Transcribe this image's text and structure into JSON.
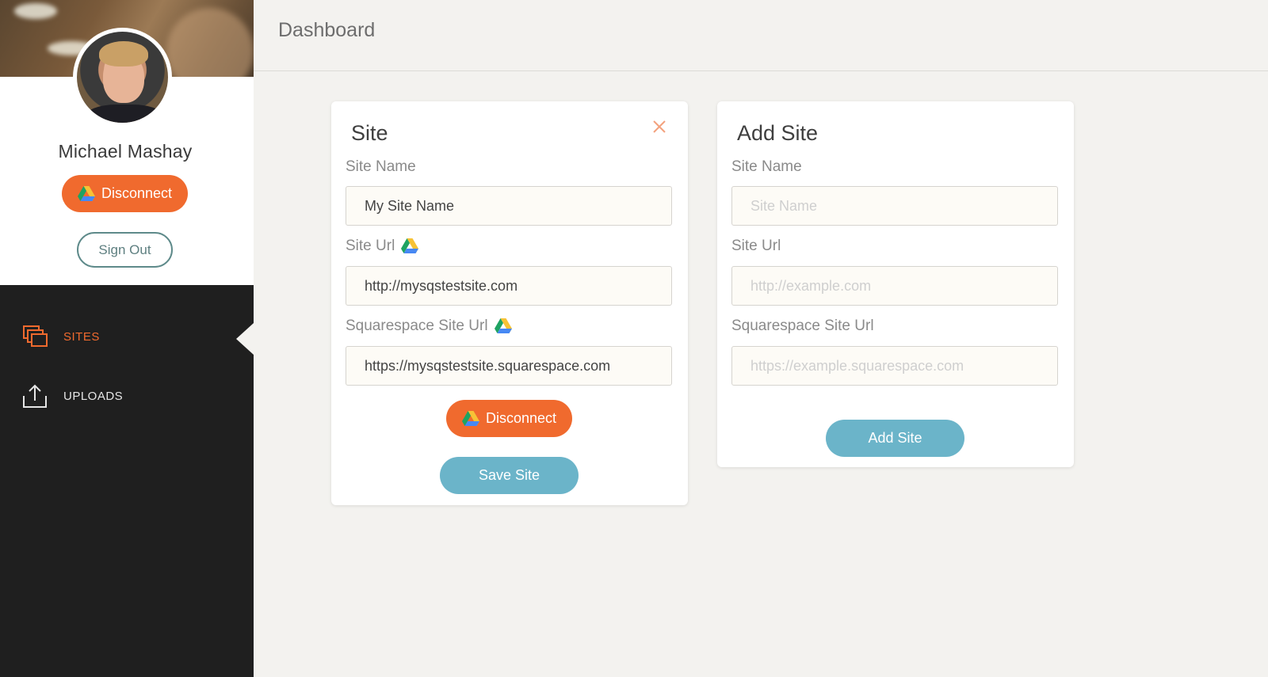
{
  "user": {
    "name": "Michael Mashay",
    "disconnect_label": "Disconnect",
    "signout_label": "Sign Out"
  },
  "nav": {
    "items": [
      {
        "label": "SITES",
        "icon": "sites-icon",
        "active": true
      },
      {
        "label": "UPLOADS",
        "icon": "upload-icon",
        "active": false
      }
    ]
  },
  "header": {
    "title": "Dashboard"
  },
  "site_card": {
    "title": "Site",
    "fields": [
      {
        "label": "Site Name",
        "value": "My Site Name"
      },
      {
        "label": "Site Url",
        "value": "http://mysqstestsite.com"
      },
      {
        "label": "Squarespace Site Url",
        "value": "https://mysqstestsite.squarespace.com"
      }
    ],
    "disconnect_label": "Disconnect",
    "save_label": "Save Site"
  },
  "add_card": {
    "title": "Add Site",
    "fields": [
      {
        "label": "Site Name",
        "placeholder": "Site Name"
      },
      {
        "label": "Site Url",
        "placeholder": "http://example.com"
      },
      {
        "label": "Squarespace Site Url",
        "placeholder": "https://example.squarespace.com"
      }
    ],
    "add_label": "Add Site"
  },
  "colors": {
    "accent_orange": "#f06a2e",
    "accent_blue": "#6bb4c9",
    "sidebar_bg": "#1f1f1f",
    "page_bg": "#f3f2ef"
  }
}
